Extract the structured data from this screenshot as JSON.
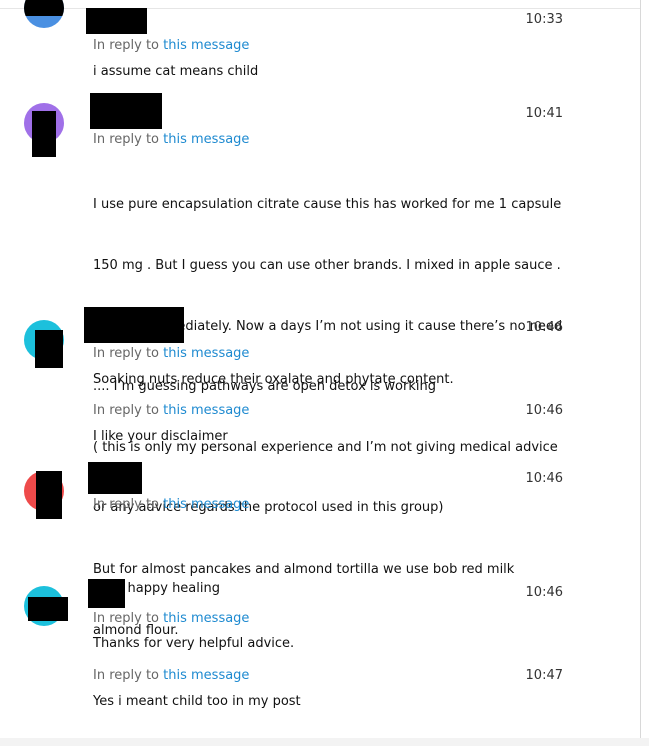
{
  "chat": {
    "reply_prefix": "In reply to",
    "reply_link": "this message",
    "messages": [
      {
        "time": "10:33",
        "avatar_color": "#4a90e2",
        "text": "i assume cat means child"
      },
      {
        "time": "10:41",
        "avatar_color": "#a070e8",
        "lines": [
          "I use pure encapsulation citrate cause this has worked for me 1 capsule",
          "150 mg . But I guess you can use other brands. I mixed in apple sauce .",
          "It works immediately. Now a days I’m not using it cause there’s no need",
          ".... I’m guessing pathways are open detox is working",
          "( this is only my personal experience and I’m not giving medical advice",
          "or any advice regards the protocol used in this group)"
        ],
        "last_line_emoji": "rose-emoji",
        "last_line": "happy healing"
      },
      {
        "time": "10:46",
        "avatar_color": "#1cc0dc",
        "text": "Soaking nuts reduce their oxalate and phytate content."
      },
      {
        "time": "10:46",
        "text": "I like your disclaimer"
      },
      {
        "time": "10:46",
        "avatar_color": "#ee4a4a",
        "lines": [
          "But for almost pancakes and almond tortilla we use bob red milk",
          "almond flour."
        ]
      },
      {
        "time": "10:46",
        "avatar_color": "#1cc0dc",
        "text": "Thanks for very helpful advice."
      },
      {
        "time": "10:47",
        "text": "Yes i meant child too in my post"
      }
    ]
  }
}
